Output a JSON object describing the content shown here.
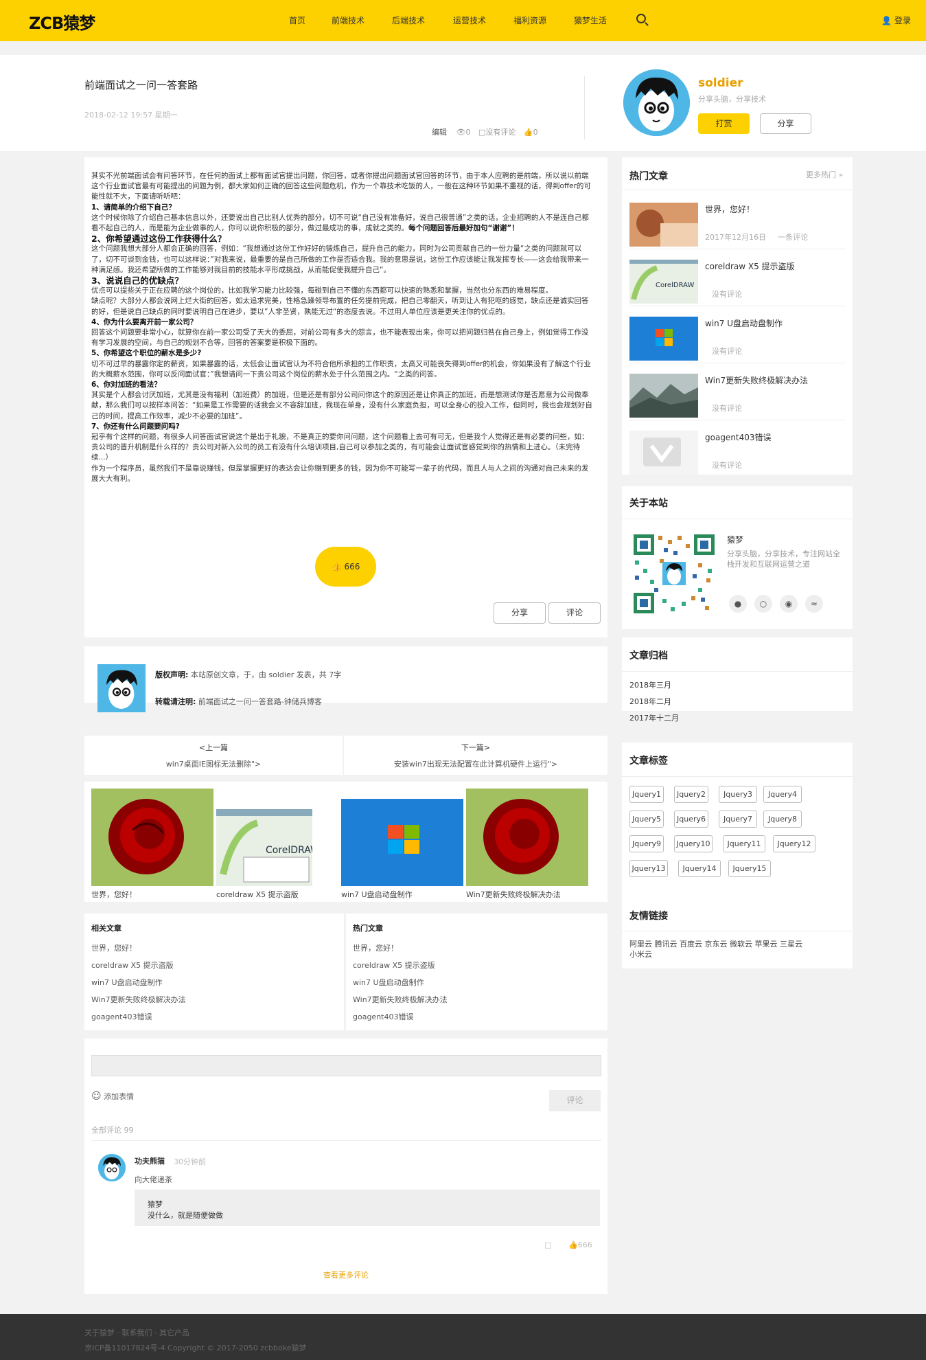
{
  "header": {
    "logo": "ZCB猿梦",
    "nav": [
      "首页",
      "前端技术",
      "后端技术",
      "运营技术",
      "福利资源",
      "猿梦生活"
    ],
    "login": "登录"
  },
  "post": {
    "title": "前端面试之一问一答套路",
    "date": "2018-02-12 19:57 星期一",
    "edit": "编辑",
    "views": "0",
    "comments": "没有评论",
    "likes": "0"
  },
  "author": {
    "name": "soldier",
    "desc": "分享头脑，分享技术",
    "reward": "打赏",
    "share": "分享"
  },
  "article": {
    "paragraphs": [
      {
        "t": "其实不光前端面试会有问答环节，在任何的面试上都有面试官提出问题，你回答，或者你提出问题面试官回答的环节，由于本人应聘的是前端，所以说以前端这个行业面试官最有可能提出的问题为例，都大家如何正确的回答这些问题危机，作为一个靠技术吃饭的人，一般在这种环节如果不重视的话，得到offer的可能性就不大，下面请听听吧："
      },
      {
        "h": "1、请简单的介绍下自己？"
      },
      {
        "t": "这个时候你除了介绍自己基本信息以外，还要说出自己比别人优秀的部分，切不可说“自己没有准备好，说自己很普通”之类的话，企业招聘的人不是连自己都看不起自己的人，而是能为企业做事的人，你可以说你积极的部分，做过最成功的事，成就之类的。",
        "b": "每个问题回答后最好加句“谢谢”！"
      },
      {
        "h2": "2、你希望通过这份工作获得什么？"
      },
      {
        "t": "这个问题我想大部分人都会正确的回答，例如：“我想通过这份工作好好的锻炼自己，提升自己的能力，同时为公司贡献自己的一份力量“之类的问题就可以了，切不可谈到金钱，也可以这样说：”对我来说，最重要的是自己所做的工作是否适合我。我的意思是说，这份工作应该能让我发挥专长——这会给我带来一种满足感。我还希望所做的工作能够对我目前的技能水平形成挑战，从而能促使我提升自己“。"
      },
      {
        "h2": "3、说说自己的优缺点？"
      },
      {
        "t": "优点可以提些关于正在应聘的这个岗位的，比如我学习能力比较强，每碰到自己不懂的东西都可以快速的熟悉和掌握，当然也分东西的难易程度。"
      },
      {
        "t": "缺点呢？大部分人都会说网上烂大街的回答，如太追求完美，性格急躁领导布置的任务提前完成，把自己零翻天，听到让人有犯呕的感觉，缺点还是诚实回答的好，但是说自己缺点的同时要说明自己在进步，要以”人非圣贤，孰能无过“的态度去说。不过用人单位应该是更关注你的优点的。"
      },
      {
        "h": "4、你为什么要离开前一家公司？"
      },
      {
        "t": "回答这个问题要非常小心，就算你在前一家公司受了天大的委屈，对前公司有多大的怨言，也不能表现出来，你可以把问题归咎在自己身上，例如觉得工作没有学习发展的空间，与自己的规划不合等，回答的答案要是积极下面的。"
      },
      {
        "h": "5、你希望这个职位的薪水是多少?"
      },
      {
        "t": "切不可过早的暴露你定的薪资，如果暴露的话，太低会让面试官认为不符合他所承担的工作职责，太高又可能丧失得到offer的机会，你如果没有了解这个行业的大概薪水范围，你可以反问面试官：”我想请问一下贵公司这个岗位的薪水处于什么范围之内。“之类的问答。"
      },
      {
        "h": "6、你对加班的看法？"
      },
      {
        "t": "其实是个人都会讨厌加班，尤其是没有福利（加班费）的加班，但是还是有部分公司问你这个的原因还是让你真正的加班，而是想测试你是否愿意为公司做奉献，那么我们可以按样本问答：“如果是工作需要的话我会义不容辞加班，我现在单身，没有什么家庭负担，可以全身心的投入工作，但同时，我也会规划好自己的时间，提高工作效率，减少不必要的加班”。"
      },
      {
        "h": "7、你还有什么问题要问吗?"
      },
      {
        "t": "冠乎有个这样的问题，有很多人问答面试官说这个是出于礼貌，不是真正的要你问问题，这个问题看上去可有可无，但是我个人觉得还是有必要的问些，如：贵公司的晋升机制是什么样的？贵公司对新入公司的员工有没有什么培训项目,自己可以参加之类的，有可能会让面试官感觉到你的热情和上进心。（未完待续...）"
      },
      {
        "t": "作为一个程序员，虽然我们不是靠说赚钱，但是掌握更好的表达会让你赚到更多的钱，因为你不可能写一辈子的代码，而且人与人之间的沟通对自己未来的发展大大有利。"
      }
    ],
    "like_count": "666",
    "share": "分享",
    "comment": "评论"
  },
  "copyright": {
    "label1": "版权声明:",
    "text1": "本站原创文章，于，由 soldier 发表，共 7字",
    "label2": "转载请注明:",
    "text2": "前端面试之一问一答套路-钟储兵博客"
  },
  "prevnext": {
    "prev_label": "<上一篇",
    "prev_title": "win7桌面IE图标无法删除\">",
    "next_label": "下一篇>",
    "next_title": "安装win7出现无法配置在此计算机硬件上运行\">"
  },
  "gallery": [
    "世界，您好！",
    "coreldraw X5 提示盗版",
    "win7 U盘启动盘制作",
    "Win7更新失败终极解决办法"
  ],
  "related": {
    "title": "相关文章",
    "items": [
      "世界，您好！",
      "coreldraw X5 提示盗版",
      "win7 U盘启动盘制作",
      "Win7更新失败终极解决办法",
      "goagent403错误"
    ]
  },
  "hot_bottom": {
    "title": "热门文章",
    "items": [
      "世界，您好！",
      "coreldraw X5 提示盗版",
      "win7 U盘启动盘制作",
      "Win7更新失败终极解决办法",
      "goagent403错误"
    ]
  },
  "comment_form": {
    "emoji": "添加表情",
    "submit": "评论",
    "all": "全部评论 99"
  },
  "comment": {
    "user": "功夫熊猫",
    "time": "30分钟前",
    "text": "向大佬递茶",
    "reply_user": "猿梦",
    "reply_text": "没什么，就是随便做做",
    "likes": "666",
    "more": "查看更多评论"
  },
  "sidebar": {
    "hot": {
      "title": "热门文章",
      "more": "更多热门 »",
      "items": [
        {
          "title": "世界，您好！",
          "date": "2017年12月16日",
          "comments": "一条评论"
        },
        {
          "title": "coreldraw X5 提示盗版",
          "date": "",
          "comments": "没有评论"
        },
        {
          "title": "win7 U盘启动盘制作",
          "date": "",
          "comments": "没有评论"
        },
        {
          "title": "Win7更新失败终极解决办法",
          "date": "",
          "comments": "没有评论"
        },
        {
          "title": "goagent403错误",
          "date": "",
          "comments": "没有评论"
        }
      ]
    },
    "about": {
      "title": "关于本站",
      "name": "猿梦",
      "desc": "分享头脑，分享技术，专注网站全栈开发和互联网运营之道"
    },
    "archive": {
      "title": "文章归档",
      "items": [
        "2018年三月",
        "2018年二月",
        "2017年十二月"
      ]
    },
    "tags": {
      "title": "文章标签",
      "items": [
        "Jquery1",
        "Jquery2",
        "Jquery3",
        "Jquery4",
        "Jquery5",
        "Jquery6",
        "Jquery7",
        "Jquery8",
        "Jquery9",
        "Jquery10",
        "Jquery11",
        "Jquery12",
        "Jquery13",
        "Jquery14",
        "Jquery15"
      ]
    },
    "links": {
      "title": "友情链接",
      "items": [
        "阿里云",
        "腾讯云",
        "百度云",
        "京东云",
        "微软云",
        "苹果云",
        "三星云",
        "小米云"
      ]
    }
  },
  "footer": {
    "links": "关于猿梦 · 联系我们 · 其它产品",
    "copy": "京ICP备11017824号-4 Copyright © 2017-2050 zcbboke猿梦"
  },
  "colors": {
    "accent": "#fdd000",
    "author": "#e8a000"
  }
}
